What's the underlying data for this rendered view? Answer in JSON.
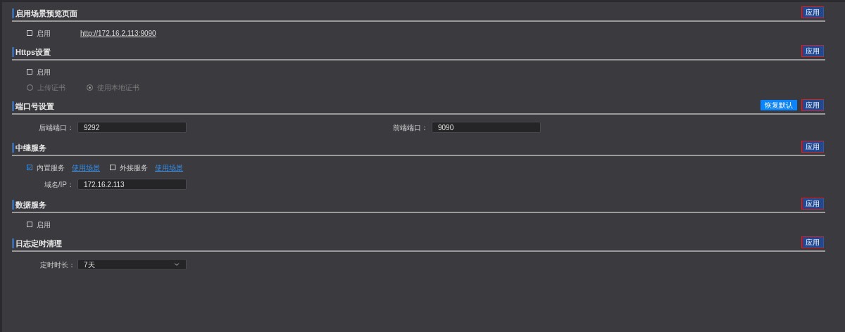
{
  "sections": [
    {
      "title": "启用场景预览页面",
      "buttons": [
        {
          "kind": "apply",
          "label": "应用"
        }
      ],
      "rows": [
        [
          {
            "kind": "checkbox",
            "label": "启用",
            "checked": false
          },
          {
            "kind": "url",
            "text": "http://172.16.2.113:9090"
          }
        ]
      ]
    },
    {
      "title": "Https设置",
      "buttons": [
        {
          "kind": "apply",
          "label": "应用"
        }
      ],
      "rows": [
        [
          {
            "kind": "checkbox",
            "label": "启用",
            "checked": false
          }
        ],
        [
          {
            "kind": "radio",
            "label": "上传证书",
            "selected": false,
            "disabled": true
          },
          {
            "kind": "radio",
            "label": "使用本地证书",
            "selected": true,
            "disabled": true
          }
        ]
      ]
    },
    {
      "title": "端口号设置",
      "buttons": [
        {
          "kind": "reset",
          "label": "恢复默认"
        },
        {
          "kind": "apply",
          "label": "应用"
        }
      ],
      "rows": [
        [
          {
            "kind": "field",
            "label": "后端端口：",
            "value": "9292"
          },
          {
            "kind": "field",
            "label": "前端端口：",
            "value": "9090"
          }
        ]
      ]
    },
    {
      "title": "中继服务",
      "buttons": [
        {
          "kind": "apply",
          "label": "应用"
        }
      ],
      "rows": [
        [
          {
            "kind": "checkbox",
            "label": "内置服务",
            "checked": true
          },
          {
            "kind": "link",
            "text": "使用场景"
          },
          {
            "kind": "checkbox",
            "label": "外接服务",
            "checked": false
          },
          {
            "kind": "link",
            "text": "使用场景"
          }
        ],
        [
          {
            "kind": "field",
            "label": "域名/IP：",
            "value": "172.16.2.113"
          }
        ]
      ]
    },
    {
      "title": "数据服务",
      "buttons": [
        {
          "kind": "apply",
          "label": "应用"
        }
      ],
      "rows": [
        [
          {
            "kind": "checkbox",
            "label": "启用",
            "checked": false
          }
        ]
      ]
    },
    {
      "title": "日志定时清理",
      "buttons": [
        {
          "kind": "apply",
          "label": "应用"
        }
      ],
      "rows": [
        [
          {
            "kind": "select",
            "label": "定时时长：",
            "value": "7天"
          }
        ]
      ]
    }
  ]
}
